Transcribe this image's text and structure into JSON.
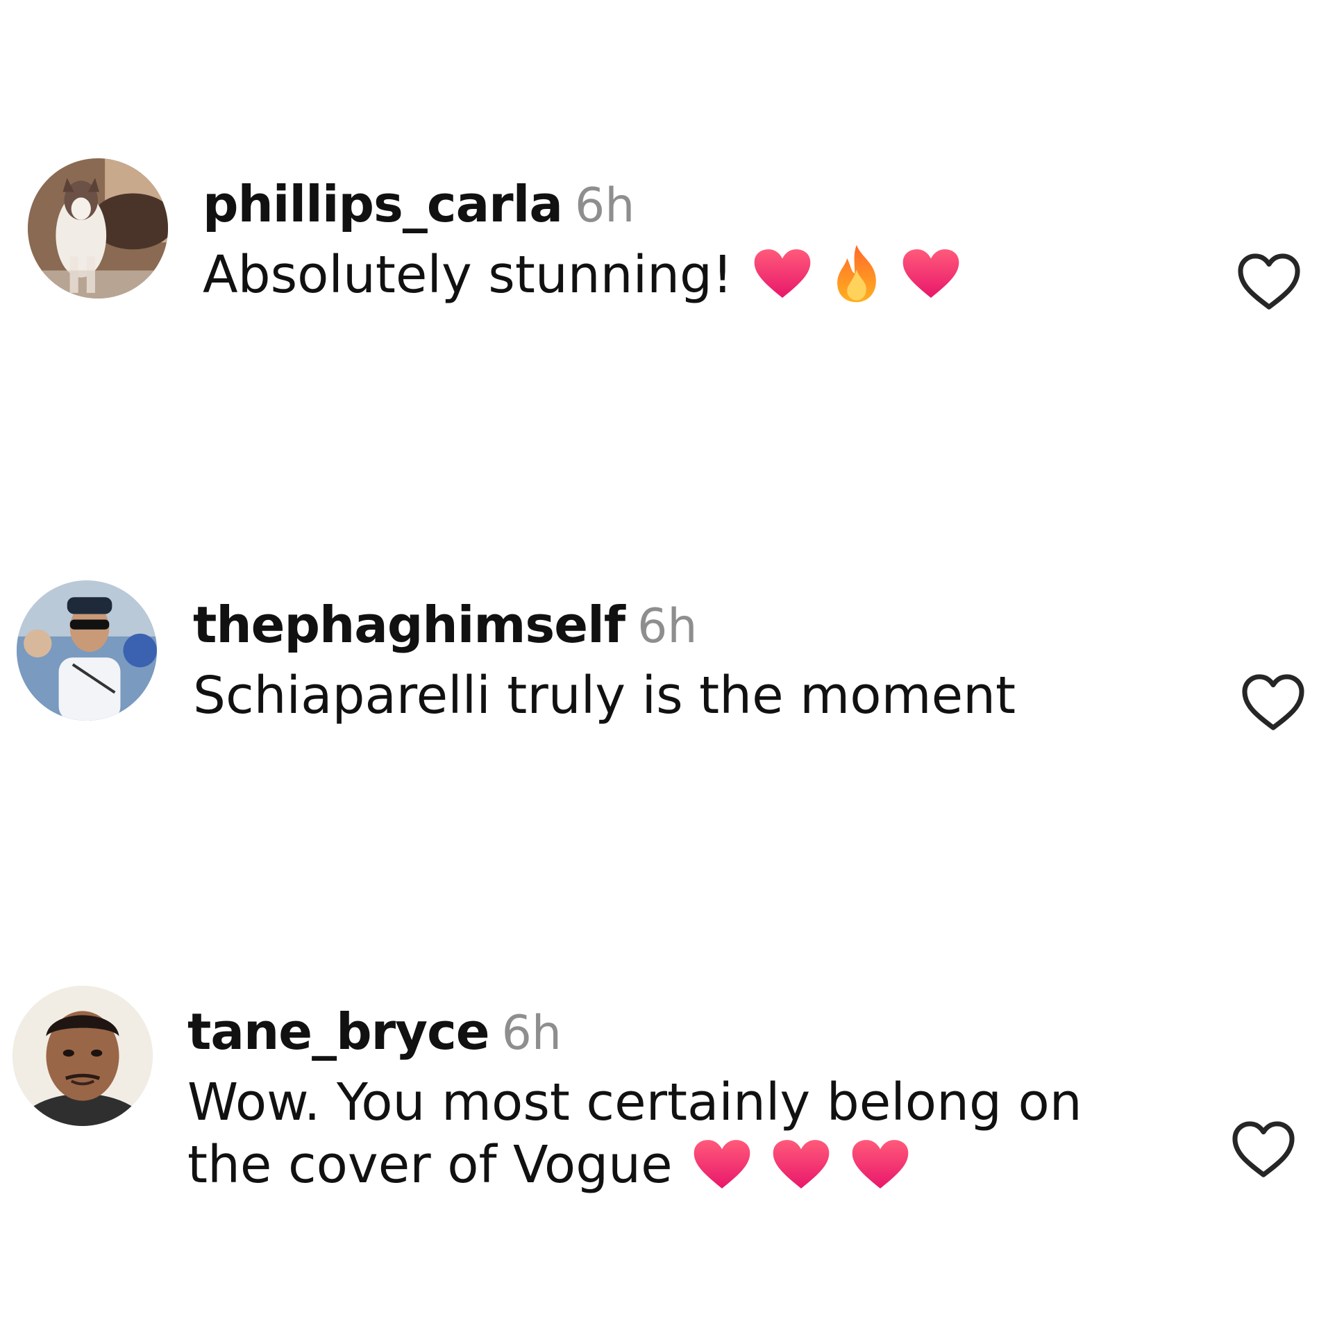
{
  "comments": [
    {
      "username": "phillips_carla",
      "time": "6h",
      "lines": [
        "Absolutely stunning!"
      ],
      "emojis": [
        "red-heart-emoji",
        "fire-emoji",
        "red-heart-emoji"
      ]
    },
    {
      "username": "thephaghimself",
      "time": "6h",
      "lines": [
        "Schiaparelli truly is the moment"
      ],
      "emojis": []
    },
    {
      "username": "tane_bryce",
      "time": "6h",
      "lines": [
        "Wow. You most certainly belong on",
        "the cover of Vogue"
      ],
      "emojis": [
        "red-heart-emoji",
        "red-heart-emoji",
        "red-heart-emoji"
      ]
    }
  ],
  "colors": {
    "text": "#111111",
    "timestamp": "#8e8e8e",
    "heart_outline": "#262626",
    "heart_emoji": "#f2366b",
    "fire_emoji": "#ff8a1f"
  },
  "icons": {
    "like": "heart-outline-icon"
  }
}
